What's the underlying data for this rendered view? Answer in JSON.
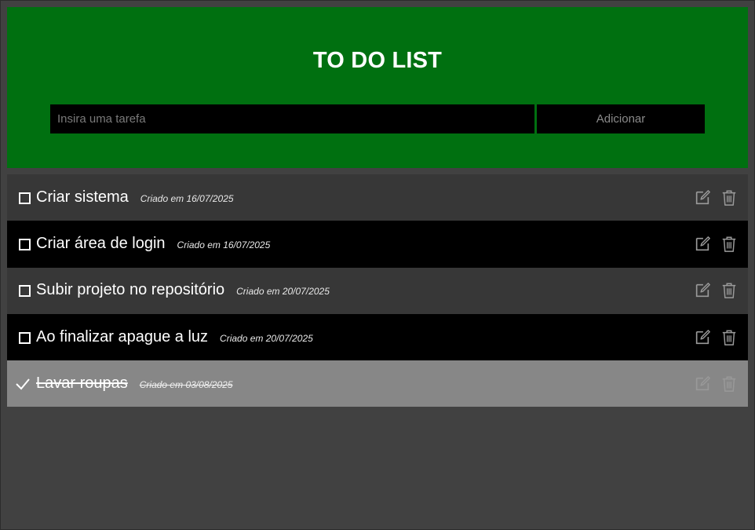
{
  "header": {
    "title": "TO DO LIST",
    "input_placeholder": "Insira uma tarefa",
    "add_label": "Adicionar"
  },
  "tasks": [
    {
      "name": "Criar sistema",
      "date": "Criado em 16/07/2025",
      "done": false
    },
    {
      "name": "Criar área de login",
      "date": "Criado em 16/07/2025",
      "done": false
    },
    {
      "name": "Subir projeto no repositório",
      "date": "Criado em 20/07/2025",
      "done": false
    },
    {
      "name": "Ao finalizar apague a luz",
      "date": "Criado em 20/07/2025",
      "done": false
    },
    {
      "name": "Lavar roupas",
      "date": "Criado em 03/08/2025",
      "done": true
    }
  ],
  "icons": {
    "edit": "edit-icon",
    "delete": "trash-icon",
    "check": "checkmark-icon"
  },
  "colors": {
    "header_bg": "#007010",
    "page_bg": "#414141",
    "row_gray": "#373737",
    "row_black": "#000000",
    "row_done": "#878787"
  }
}
